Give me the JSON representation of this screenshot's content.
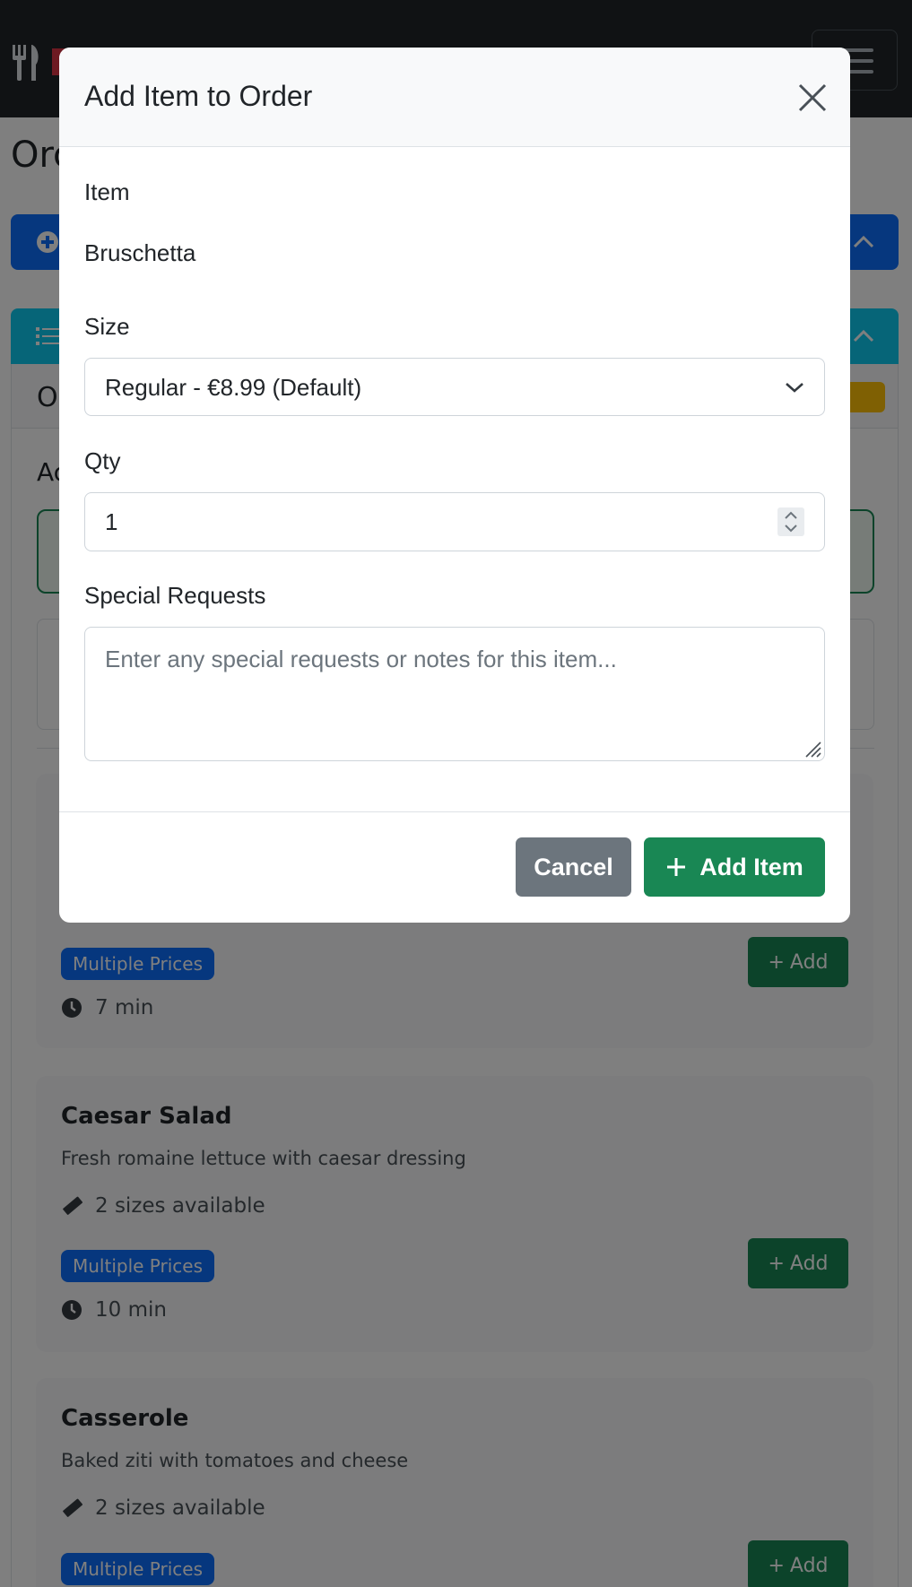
{
  "background": {
    "page_title": "Orc",
    "order_panel_heading": "O",
    "order_panel_sublabel": "Ac",
    "menu_items": [
      {
        "badge": "Multiple Prices",
        "time": "7 min",
        "add_label": "Add"
      },
      {
        "name": "Caesar Salad",
        "description": "Fresh romaine lettuce with caesar dressing",
        "sizes": "2 sizes available",
        "badge": "Multiple Prices",
        "time": "10 min",
        "add_label": "Add"
      },
      {
        "name": "Casserole",
        "description": "Baked ziti with tomatoes and cheese",
        "sizes": "2 sizes available",
        "badge": "Multiple Prices",
        "add_label": "Add"
      }
    ]
  },
  "modal": {
    "title": "Add Item to Order",
    "item_label": "Item",
    "item_value": "Bruschetta",
    "size_label": "Size",
    "size_selected": "Regular - €8.99 (Default)",
    "qty_label": "Qty",
    "qty_value": "1",
    "special_label": "Special Requests",
    "special_placeholder": "Enter any special requests or notes for this item...",
    "cancel_label": "Cancel",
    "add_label": "Add Item"
  },
  "colors": {
    "primary": "#0d6efd",
    "success": "#198754",
    "info": "#0dcaf0",
    "secondary": "#6c757d",
    "navbar": "#212529"
  },
  "icons": [
    "utensils-icon",
    "hamburger-menu-icon",
    "plus-circle-icon",
    "list-icon",
    "chevron-up-icon",
    "ruler-icon",
    "clock-icon",
    "plus-icon",
    "close-icon",
    "chevron-down-icon"
  ]
}
